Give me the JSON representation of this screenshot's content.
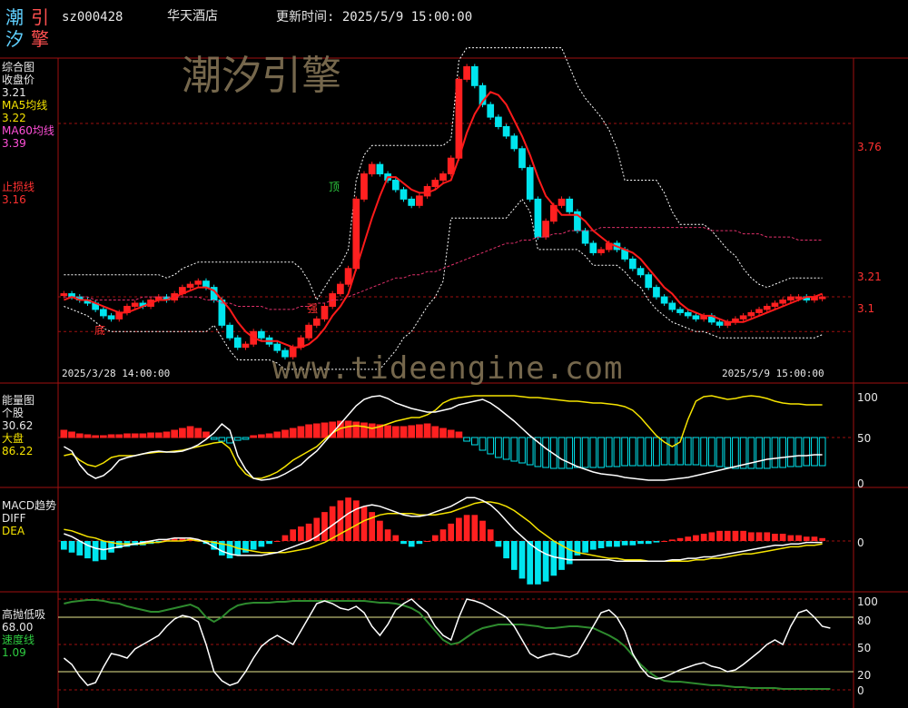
{
  "header": {
    "logo_chars": [
      "潮",
      "引",
      "汐",
      "擎"
    ],
    "code": "sz000428",
    "name": "华天酒店",
    "update_time": "更新时间: 2025/5/9 15:00:00"
  },
  "watermark": {
    "brand": "潮汐引擎",
    "url": "www.tideengine.com"
  },
  "colors": {
    "up": "#ff2020",
    "down": "#00e5ee",
    "ma5": "#ffffff",
    "ma60": "#e0306a",
    "stop": "#ff2020",
    "axis": "#a01010"
  },
  "main_panel": {
    "title": "综合图",
    "close_label": "收盘价",
    "close_value": "3.21",
    "ma5_label": "MA5均线",
    "ma5_value": "3.22",
    "ma60_label": "MA60均线",
    "ma60_value": "3.39",
    "stop_label": "止损线",
    "stop_value": "3.16",
    "start_date": "2025/3/28 14:00:00",
    "end_date": "2025/5/9 15:00:00",
    "price_levels": [
      "3.76",
      "3.21",
      "3.1"
    ],
    "marks": {
      "bottom": "底",
      "strong": "强",
      "top": "顶"
    }
  },
  "energy_panel": {
    "title": "能量图",
    "stock_label": "个股",
    "stock_value": "30.62",
    "market_label": "大盘",
    "market_value": "86.22",
    "levels": [
      "100",
      "50",
      "0"
    ]
  },
  "macd_panel": {
    "title": "MACD趋势",
    "diff_label": "DIFF",
    "dea_label": "DEA",
    "levels": [
      "0"
    ]
  },
  "osc_panel": {
    "title": "高抛低吸",
    "value": "68.00",
    "speed_label": "速度线",
    "speed_value": "1.09",
    "levels": [
      "100",
      "80",
      "50",
      "20",
      "0"
    ]
  },
  "chart_data": {
    "type": "candlestick",
    "x_range": [
      "2025/3/28 14:00:00",
      "2025/5/9 15:00:00"
    ],
    "price_range": [
      3.0,
      3.95
    ],
    "closes": [
      3.22,
      3.21,
      3.2,
      3.19,
      3.17,
      3.15,
      3.14,
      3.16,
      3.18,
      3.19,
      3.18,
      3.2,
      3.21,
      3.2,
      3.22,
      3.24,
      3.25,
      3.26,
      3.24,
      3.2,
      3.12,
      3.08,
      3.05,
      3.06,
      3.1,
      3.08,
      3.06,
      3.04,
      3.02,
      3.05,
      3.08,
      3.12,
      3.14,
      3.18,
      3.22,
      3.25,
      3.3,
      3.52,
      3.6,
      3.63,
      3.6,
      3.58,
      3.55,
      3.52,
      3.5,
      3.53,
      3.56,
      3.58,
      3.6,
      3.65,
      3.9,
      3.94,
      3.88,
      3.82,
      3.78,
      3.75,
      3.72,
      3.68,
      3.62,
      3.52,
      3.4,
      3.45,
      3.5,
      3.52,
      3.48,
      3.42,
      3.38,
      3.35,
      3.36,
      3.38,
      3.36,
      3.33,
      3.3,
      3.28,
      3.24,
      3.21,
      3.19,
      3.17,
      3.16,
      3.15,
      3.14,
      3.15,
      3.13,
      3.12,
      3.13,
      3.14,
      3.15,
      3.16,
      3.17,
      3.18,
      3.19,
      3.2,
      3.21,
      3.21,
      3.2,
      3.21,
      3.21
    ],
    "ma5": [
      3.2,
      3.21,
      3.2,
      3.2,
      3.19,
      3.18,
      3.17,
      3.16,
      3.16,
      3.17,
      3.18,
      3.19,
      3.2,
      3.2,
      3.21,
      3.22,
      3.23,
      3.24,
      3.24,
      3.23,
      3.2,
      3.17,
      3.13,
      3.1,
      3.08,
      3.07,
      3.07,
      3.07,
      3.06,
      3.05,
      3.05,
      3.06,
      3.08,
      3.11,
      3.15,
      3.18,
      3.22,
      3.3,
      3.38,
      3.46,
      3.53,
      3.59,
      3.59,
      3.57,
      3.55,
      3.54,
      3.54,
      3.55,
      3.57,
      3.58,
      3.65,
      3.73,
      3.79,
      3.83,
      3.86,
      3.85,
      3.82,
      3.77,
      3.72,
      3.66,
      3.59,
      3.53,
      3.5,
      3.47,
      3.47,
      3.47,
      3.45,
      3.42,
      3.4,
      3.38,
      3.37,
      3.36,
      3.35,
      3.33,
      3.3,
      3.27,
      3.24,
      3.22,
      3.19,
      3.17,
      3.16,
      3.15,
      3.15,
      3.14,
      3.13,
      3.13,
      3.13,
      3.14,
      3.15,
      3.16,
      3.17,
      3.18,
      3.19,
      3.2,
      3.21,
      3.21,
      3.22
    ],
    "ma60": [
      3.21,
      3.21,
      3.21,
      3.21,
      3.2,
      3.2,
      3.2,
      3.2,
      3.2,
      3.2,
      3.21,
      3.21,
      3.21,
      3.21,
      3.21,
      3.21,
      3.21,
      3.21,
      3.2,
      3.2,
      3.19,
      3.19,
      3.18,
      3.18,
      3.18,
      3.18,
      3.17,
      3.17,
      3.17,
      3.17,
      3.18,
      3.18,
      3.19,
      3.19,
      3.2,
      3.2,
      3.21,
      3.22,
      3.23,
      3.24,
      3.25,
      3.26,
      3.27,
      3.27,
      3.28,
      3.28,
      3.29,
      3.29,
      3.3,
      3.31,
      3.32,
      3.33,
      3.34,
      3.35,
      3.36,
      3.37,
      3.38,
      3.38,
      3.39,
      3.39,
      3.4,
      3.4,
      3.41,
      3.41,
      3.42,
      3.42,
      3.42,
      3.42,
      3.43,
      3.43,
      3.43,
      3.43,
      3.43,
      3.43,
      3.43,
      3.43,
      3.43,
      3.43,
      3.43,
      3.43,
      3.43,
      3.43,
      3.42,
      3.42,
      3.42,
      3.42,
      3.41,
      3.41,
      3.41,
      3.4,
      3.4,
      3.4,
      3.4,
      3.39,
      3.39,
      3.39,
      3.39
    ],
    "energy_stock": [
      40,
      35,
      20,
      10,
      5,
      8,
      15,
      25,
      28,
      30,
      32,
      34,
      35,
      34,
      34,
      35,
      38,
      42,
      48,
      55,
      65,
      58,
      30,
      15,
      5,
      3,
      4,
      6,
      10,
      15,
      20,
      28,
      35,
      45,
      55,
      65,
      75,
      85,
      92,
      95,
      96,
      93,
      88,
      85,
      82,
      80,
      78,
      78,
      80,
      82,
      86,
      88,
      90,
      92,
      88,
      82,
      75,
      68,
      60,
      52,
      45,
      38,
      32,
      26,
      22,
      18,
      15,
      12,
      10,
      9,
      8,
      6,
      5,
      4,
      3,
      3,
      3,
      4,
      5,
      6,
      8,
      10,
      12,
      14,
      16,
      18,
      20,
      22,
      24,
      26,
      27,
      28,
      29,
      30,
      30,
      31,
      31
    ],
    "energy_market": [
      30,
      32,
      25,
      20,
      18,
      22,
      28,
      30,
      30,
      30,
      32,
      33,
      34,
      34,
      35,
      36,
      38,
      40,
      42,
      44,
      45,
      38,
      20,
      10,
      5,
      5,
      8,
      12,
      18,
      25,
      30,
      35,
      40,
      48,
      55,
      60,
      62,
      63,
      62,
      60,
      62,
      65,
      68,
      70,
      72,
      72,
      75,
      80,
      88,
      92,
      94,
      95,
      96,
      96,
      96,
      96,
      96,
      96,
      95,
      94,
      94,
      93,
      92,
      91,
      90,
      90,
      89,
      88,
      88,
      87,
      86,
      84,
      80,
      72,
      62,
      52,
      45,
      40,
      45,
      70,
      90,
      95,
      96,
      94,
      92,
      93,
      95,
      96,
      95,
      93,
      90,
      88,
      87,
      87,
      86,
      86,
      86
    ],
    "energy_bars": [
      8,
      6,
      4,
      3,
      2,
      2,
      3,
      3,
      4,
      4,
      4,
      5,
      5,
      6,
      8,
      10,
      12,
      10,
      6,
      -2,
      -4,
      -6,
      -3,
      -2,
      2,
      3,
      4,
      6,
      8,
      10,
      12,
      14,
      15,
      16,
      17,
      18,
      18,
      17,
      16,
      15,
      14,
      13,
      12,
      12,
      13,
      14,
      15,
      12,
      10,
      8,
      6,
      -4,
      -8,
      -14,
      -18,
      -22,
      -24,
      -26,
      -28,
      -30,
      -32,
      -33,
      -34,
      -34,
      -34,
      -33,
      -33,
      -33,
      -33,
      -32,
      -32,
      -31,
      -31,
      -31,
      -31,
      -31,
      -30,
      -30,
      -30,
      -30,
      -30,
      -31,
      -31,
      -32,
      -33,
      -34,
      -34,
      -34,
      -34,
      -34,
      -33,
      -33,
      -32,
      -32,
      -31,
      -31,
      -31
    ],
    "macd_diff": [
      0.05,
      0.03,
      0,
      -0.03,
      -0.05,
      -0.06,
      -0.05,
      -0.04,
      -0.03,
      -0.02,
      -0.01,
      0,
      0.01,
      0.01,
      0.02,
      0.02,
      0.02,
      0.01,
      -0.01,
      -0.04,
      -0.07,
      -0.09,
      -0.1,
      -0.1,
      -0.1,
      -0.1,
      -0.09,
      -0.08,
      -0.06,
      -0.04,
      -0.02,
      0,
      0.03,
      0.07,
      0.11,
      0.15,
      0.19,
      0.22,
      0.24,
      0.25,
      0.24,
      0.22,
      0.2,
      0.18,
      0.17,
      0.17,
      0.18,
      0.2,
      0.22,
      0.24,
      0.27,
      0.3,
      0.3,
      0.28,
      0.25,
      0.2,
      0.14,
      0.08,
      0.03,
      -0.02,
      -0.06,
      -0.09,
      -0.11,
      -0.12,
      -0.13,
      -0.13,
      -0.13,
      -0.13,
      -0.13,
      -0.13,
      -0.14,
      -0.14,
      -0.14,
      -0.14,
      -0.14,
      -0.14,
      -0.14,
      -0.13,
      -0.13,
      -0.12,
      -0.12,
      -0.11,
      -0.11,
      -0.1,
      -0.09,
      -0.08,
      -0.07,
      -0.06,
      -0.05,
      -0.04,
      -0.03,
      -0.03,
      -0.02,
      -0.02,
      -0.01,
      -0.01,
      -0.01
    ],
    "macd_dea": [
      0.08,
      0.07,
      0.05,
      0.03,
      0.02,
      0,
      -0.01,
      -0.02,
      -0.02,
      -0.02,
      -0.02,
      -0.01,
      -0.01,
      0,
      0,
      0,
      0.01,
      0,
      0,
      -0.01,
      -0.02,
      -0.03,
      -0.05,
      -0.06,
      -0.07,
      -0.08,
      -0.08,
      -0.08,
      -0.08,
      -0.07,
      -0.06,
      -0.05,
      -0.03,
      -0.01,
      0.02,
      0.05,
      0.08,
      0.11,
      0.14,
      0.16,
      0.18,
      0.19,
      0.19,
      0.19,
      0.19,
      0.18,
      0.18,
      0.18,
      0.19,
      0.2,
      0.22,
      0.24,
      0.26,
      0.27,
      0.27,
      0.26,
      0.24,
      0.21,
      0.17,
      0.13,
      0.08,
      0.04,
      0,
      -0.03,
      -0.06,
      -0.08,
      -0.09,
      -0.1,
      -0.11,
      -0.12,
      -0.12,
      -0.13,
      -0.13,
      -0.13,
      -0.14,
      -0.14,
      -0.14,
      -0.14,
      -0.14,
      -0.14,
      -0.13,
      -0.13,
      -0.12,
      -0.12,
      -0.11,
      -0.1,
      -0.09,
      -0.09,
      -0.08,
      -0.07,
      -0.06,
      -0.05,
      -0.04,
      -0.04,
      -0.03,
      -0.03,
      -0.02
    ],
    "macd_bars": [
      -0.06,
      -0.08,
      -0.1,
      -0.12,
      -0.14,
      -0.13,
      -0.08,
      -0.05,
      -0.04,
      -0.03,
      -0.03,
      -0.02,
      -0.01,
      0.01,
      0.02,
      0.02,
      0.02,
      0.01,
      -0.02,
      -0.06,
      -0.1,
      -0.12,
      -0.1,
      -0.08,
      -0.06,
      -0.04,
      -0.02,
      0,
      0.04,
      0.08,
      0.1,
      0.12,
      0.16,
      0.2,
      0.24,
      0.28,
      0.3,
      0.28,
      0.24,
      0.2,
      0.14,
      0.08,
      0.04,
      -0.02,
      -0.04,
      -0.02,
      0,
      0.04,
      0.08,
      0.12,
      0.16,
      0.18,
      0.18,
      0.14,
      0.08,
      -0.04,
      -0.12,
      -0.2,
      -0.26,
      -0.3,
      -0.3,
      -0.28,
      -0.24,
      -0.2,
      -0.16,
      -0.1,
      -0.08,
      -0.06,
      -0.05,
      -0.04,
      -0.04,
      -0.03,
      -0.03,
      -0.02,
      -0.02,
      -0.01,
      0,
      0.01,
      0.02,
      0.03,
      0.04,
      0.05,
      0.06,
      0.07,
      0.07,
      0.07,
      0.07,
      0.06,
      0.06,
      0.06,
      0.05,
      0.05,
      0.04,
      0.04,
      0.03,
      0.03,
      0.02
    ],
    "osc_white": [
      35,
      28,
      15,
      5,
      8,
      25,
      40,
      38,
      35,
      45,
      50,
      55,
      60,
      70,
      78,
      82,
      80,
      75,
      50,
      20,
      10,
      5,
      8,
      20,
      35,
      48,
      55,
      60,
      55,
      50,
      65,
      80,
      95,
      98,
      95,
      90,
      88,
      92,
      85,
      70,
      60,
      72,
      88,
      95,
      100,
      92,
      85,
      70,
      60,
      55,
      80,
      100,
      98,
      95,
      90,
      85,
      80,
      70,
      55,
      40,
      35,
      38,
      40,
      38,
      36,
      40,
      55,
      70,
      85,
      88,
      80,
      65,
      40,
      25,
      15,
      12,
      14,
      18,
      22,
      25,
      28,
      30,
      26,
      24,
      20,
      22,
      28,
      35,
      42,
      50,
      55,
      50,
      70,
      85,
      88,
      80,
      70,
      68
    ],
    "osc_green": [
      95,
      97,
      98,
      99,
      99,
      98,
      96,
      95,
      92,
      90,
      88,
      86,
      86,
      88,
      90,
      92,
      94,
      90,
      80,
      75,
      80,
      88,
      93,
      95,
      96,
      96,
      96,
      97,
      97,
      98,
      98,
      98,
      98,
      98,
      98,
      98,
      98,
      98,
      98,
      97,
      96,
      96,
      95,
      93,
      90,
      85,
      75,
      65,
      55,
      50,
      52,
      58,
      64,
      68,
      70,
      72,
      72,
      72,
      72,
      71,
      70,
      68,
      68,
      69,
      70,
      70,
      69,
      68,
      64,
      60,
      55,
      48,
      38,
      28,
      20,
      14,
      10,
      9,
      9,
      8,
      7,
      6,
      5,
      5,
      4,
      3,
      3,
      2,
      2,
      2,
      2,
      1,
      1,
      1,
      1,
      1,
      1,
      1
    ]
  }
}
